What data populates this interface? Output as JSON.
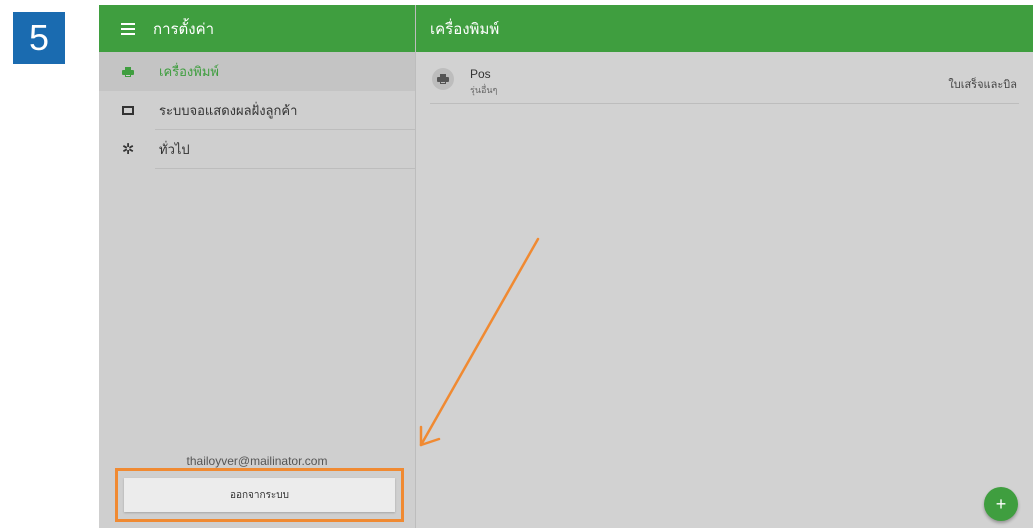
{
  "step_number": "5",
  "sidebar": {
    "title": "การตั้งค่า",
    "items": [
      {
        "label": "เครื่องพิมพ์",
        "icon": "printer-icon",
        "active": true
      },
      {
        "label": "ระบบจอแสดงผลฝั่งลูกค้า",
        "icon": "display-icon",
        "active": false
      },
      {
        "label": "ทั่วไป",
        "icon": "gear-icon",
        "active": false
      }
    ],
    "email": "thailoyver@mailinator.com",
    "logout_label": "ออกจากระบบ"
  },
  "main": {
    "title": "เครื่องพิมพ์",
    "printers": [
      {
        "name": "Pos",
        "model": "รุ่นอื่นๆ",
        "type": "ใบเสร็จและบิล"
      }
    ],
    "add_button_label": "+"
  },
  "colors": {
    "app_bar": "#3f9e3f",
    "step_badge": "#1a6bb0",
    "highlight": "#f08a32"
  }
}
